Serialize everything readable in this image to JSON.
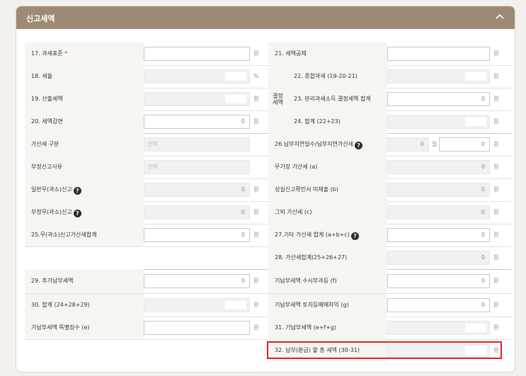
{
  "header": {
    "title": "신고세액"
  },
  "unit_won": "원",
  "unit_pct": "%",
  "unit_day": "일",
  "group_label": "결정\n세액",
  "rows": {
    "r1": {
      "left_label": "17. 과세표준",
      "left_required": "*",
      "right_label": "21. 세액공제"
    },
    "r2": {
      "left_label": "18. 세율",
      "right_label": "22. 종합과세 (19-20-21)"
    },
    "r3": {
      "left_label": "19. 산출세액",
      "right_label": "23. 분리과세소득 결정세액 합계",
      "right_value": "0"
    },
    "r4": {
      "left_label": "20. 세액감면",
      "left_value": "0",
      "right_label": "24. 합계 (22+23)"
    },
    "r5": {
      "left_label": "가산세 구분",
      "left_placeholder": "선택",
      "right_label": "26.납부지연일수/납부지연가산세",
      "right_days": "0",
      "right_value": "0"
    },
    "r6": {
      "left_label": "부정신고사유",
      "left_placeholder": "선택",
      "right_label": "무기장 가산세 (a)",
      "right_value": "0"
    },
    "r7": {
      "left_label": "일반무(과소)신고",
      "left_value": "0",
      "right_label": "성실신고확인서 미제출 (b)",
      "right_value": "0"
    },
    "r8": {
      "left_label": "부정무(과소)신고",
      "left_value": "0",
      "right_label": "그외 가산세 (c)",
      "right_value": "0"
    },
    "r9": {
      "left_label": "25.무(과소)신고가산세합계",
      "left_value": "0",
      "right_label": "27.기타 가산세 합계 (a+b+c)",
      "right_value": "0"
    },
    "r10": {
      "right_label": "28. 가산세합계(25+26+27)",
      "right_value": "0"
    },
    "r11": {
      "left_label": "29. 추가납부세액",
      "left_value": "0",
      "right_label": "기납부세액 수시부과등 (f)",
      "right_value": "0"
    },
    "r12": {
      "left_label": "30. 합계 (24+28+29)",
      "right_label": "기납부세액 토지등매매차익 (g)",
      "right_value": "0"
    },
    "r13": {
      "left_label": "기납부세액 특별징수 (e)",
      "right_label": "31. 기납부세액 (e+f+g)"
    },
    "r14": {
      "right_label": "32. 납부(환급) 할 총 세액 (30-31)"
    }
  }
}
